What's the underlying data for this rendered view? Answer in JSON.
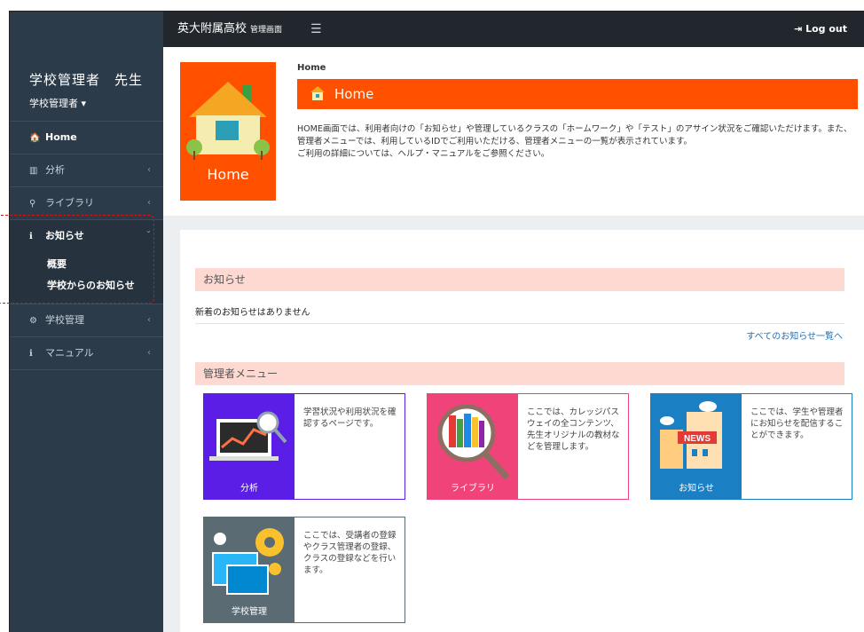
{
  "topbar": {
    "brand": "英大附属高校",
    "brand_sub": "管理画面",
    "menu_icon": "☰",
    "logout": "Log out"
  },
  "sidebar": {
    "user_name": "学校管理者　先生",
    "user_role": "学校管理者 ▾",
    "items": [
      {
        "icon": "🏠",
        "label": "Home"
      },
      {
        "icon": "▥",
        "label": "分析",
        "chev": "‹"
      },
      {
        "icon": "⚲",
        "label": "ライブラリ",
        "chev": "‹"
      },
      {
        "icon": "ℹ",
        "label": "お知らせ",
        "chev": "ˇ"
      },
      {
        "icon": "⚙",
        "label": "学校管理",
        "chev": "‹"
      },
      {
        "icon": "ℹ",
        "label": "マニュアル",
        "chev": "‹"
      }
    ],
    "submenu": [
      "概要",
      "学校からのお知らせ"
    ]
  },
  "hero": {
    "image_label": "Home",
    "breadcrumb": "Home",
    "title": "Home",
    "desc1": "HOME画面では、利用者向けの「お知らせ」や管理しているクラスの「ホームワーク」や「テスト」のアサイン状況をご確認いただけます。また、",
    "desc2": "管理者メニューでは、利用しているIDでご利用いただける、管理者メニューの一覧が表示されています。",
    "desc3": "ご利用の詳細については、ヘルプ・マニュアルをご参照ください。"
  },
  "news": {
    "header": "お知らせ",
    "empty": "新着のお知らせはありません",
    "all_link": "すべてのお知らせ一覧へ"
  },
  "admin": {
    "header": "管理者メニュー",
    "cards": [
      {
        "caption": "分析",
        "text": "学習状況や利用状況を確認するページです。",
        "color": "#5b1ee6"
      },
      {
        "caption": "ライブラリ",
        "text": "ここでは、カレッジパスウェイの全コンテンツ、先生オリジナルの教材などを管理します。",
        "color": "#f0437a"
      },
      {
        "caption": "お知らせ",
        "text": "ここでは、学生や管理者にお知らせを配信することができます。",
        "color": "#1b7fc4"
      },
      {
        "caption": "学校管理",
        "text": "ここでは、受講者の登録やクラス管理者の登録、クラスの登録などを行います。",
        "color": "#5a6b73"
      }
    ]
  }
}
